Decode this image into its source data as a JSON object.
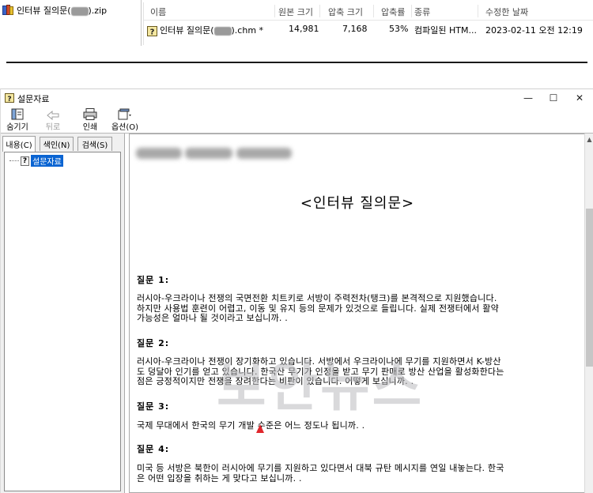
{
  "zip_viewer": {
    "archive_name_prefix": "인터뷰 질의문(",
    "archive_name_suffix": ").zip",
    "columns": [
      "이름",
      "원본 크기",
      "압축 크기",
      "압축률",
      "종류",
      "수정한 날짜"
    ],
    "row": {
      "name_prefix": "인터뷰 질의문(",
      "name_suffix": ").chm *",
      "original_size": "14,981",
      "compressed_size": "7,168",
      "ratio": "53%",
      "type": "컴파일된 HTM...",
      "modified": "2023-02-11 오전 12:19"
    }
  },
  "help_window": {
    "title": "설문자료",
    "controls": {
      "minimize": "—",
      "maximize": "☐",
      "close": "✕"
    },
    "toolbar": {
      "hide": "숨기기",
      "back": "뒤로",
      "print": "인쇄",
      "options": "옵션(O)"
    },
    "tabs": [
      "내용(C)",
      "색인(N)",
      "검색(S)"
    ],
    "tree_item": "설문자료",
    "document": {
      "title": "<인터뷰 질의문>",
      "questions": [
        {
          "heading": "질문 1:",
          "lines": [
            "러시아-우크라이나 전쟁의 국면전환 치트키로 서방이 주력전차(탱크)를 본격적으로 지원했습니다.",
            "하지만 사용법 훈련이 어렵고, 이동 및 유지 등의 문제가 있것으로 들립니다. 실제 전쟁터에서 활약",
            "가능성은 얼마나 될 것이라고 보십니까. ."
          ]
        },
        {
          "heading": "질문 2:",
          "lines": [
            "러시아-우크라이나 전쟁이 장기화하고 있습니다. 서방에서 우크라이나에 무기를 지원하면서 K-방산",
            "도 덩달아 인기를 얻고 있습니다. 한국산 무기가 인정을 받고 무기 판매로 방산 산업을 활성화한다는",
            "점은 긍정적이지만 전쟁을 장려한다는 비판이 있습니다. 어떻게 보십니까. ."
          ]
        },
        {
          "heading": "질문 3:",
          "lines": [
            "국제 무대에서 한국의 무기 개발 수준은 어느 정도나 됩니까. ."
          ]
        },
        {
          "heading": "질문 4:",
          "lines": [
            "미국 등 서방은 북한이 러시아에 무기를 지원하고 있다면서 대북 규탄 메시지를 연일 내놓는다. 한국",
            "은 어떤 입장을 취하는 게 맞다고 보십니까. ."
          ]
        }
      ]
    }
  },
  "watermark": "보안뉴스",
  "colors": {
    "selection": "#0a64d2",
    "panel": "#f0f0f0",
    "watermark": "#b9b9be"
  }
}
